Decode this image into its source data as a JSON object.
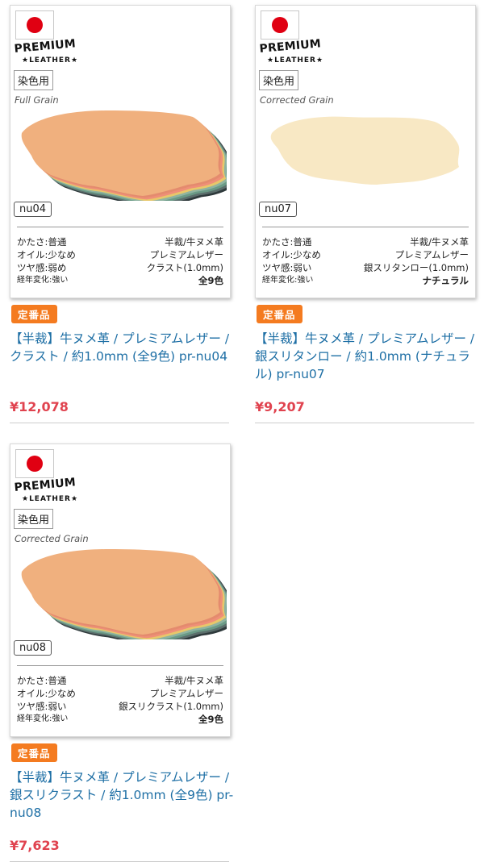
{
  "products": [
    {
      "badge_flag": "Japan flag",
      "logo_top": "PREMIUM",
      "logo_bottom": "★LEATHER★",
      "tag": "染色用",
      "grain": "Full Grain",
      "code": "nu04",
      "specs": [
        {
          "left": "かたさ:普通",
          "right": "半裁/牛ヌメ革"
        },
        {
          "left": "オイル:少なめ",
          "right": "プレミアムレザー"
        },
        {
          "left": "ツヤ感:弱め",
          "right": "クラスト(1.0mm)"
        },
        {
          "left": "経年変化:強い",
          "right": "全9色"
        }
      ],
      "badge": "定番品",
      "title": "【半裁】牛ヌメ革 / プレミアムレザー / クラスト / 約1.0mm (全9色) pr-nu04",
      "price": "¥12,078",
      "hide_layers": [
        "#2f3a3c",
        "#5b6e6c",
        "#6a9a86",
        "#8fb3a0",
        "#e8c76a",
        "#ef8f78",
        "#e48b6e",
        "#f0b07e"
      ]
    },
    {
      "badge_flag": "Japan flag",
      "logo_top": "PREMIUM",
      "logo_bottom": "★LEATHER★",
      "tag": "染色用",
      "grain": "Corrected Grain",
      "code": "nu07",
      "specs": [
        {
          "left": "かたさ:普通",
          "right": "半裁/牛ヌメ革"
        },
        {
          "left": "オイル:少なめ",
          "right": "プレミアムレザー"
        },
        {
          "left": "ツヤ感:弱い",
          "right": "銀スリタンロー(1.0mm)"
        },
        {
          "left": "経年変化:強い",
          "right": "ナチュラル"
        }
      ],
      "badge": "定番品",
      "title": "【半裁】牛ヌメ革 / プレミアムレザー / 銀スリタンロー / 約1.0mm (ナチュラル) pr-nu07",
      "price": "¥9,207",
      "hide_layers": [
        "#f8e8c4"
      ]
    },
    {
      "badge_flag": "Japan flag",
      "logo_top": "PREMIUM",
      "logo_bottom": "★LEATHER★",
      "tag": "染色用",
      "grain": "Corrected Grain",
      "code": "nu08",
      "specs": [
        {
          "left": "かたさ:普通",
          "right": "半裁/牛ヌメ革"
        },
        {
          "left": "オイル:少なめ",
          "right": "プレミアムレザー"
        },
        {
          "left": "ツヤ感:弱い",
          "right": "銀スリクラスト(1.0mm)"
        },
        {
          "left": "経年変化:強い",
          "right": "全9色"
        }
      ],
      "badge": "定番品",
      "title": "【半裁】牛ヌメ革 / プレミアムレザー / 銀スリクラスト / 約1.0mm (全9色) pr-nu08",
      "price": "¥7,623",
      "hide_layers": [
        "#2f3a3c",
        "#5b6e6c",
        "#6a9a86",
        "#8fb3a0",
        "#e8c76a",
        "#ef8f78",
        "#e48b6e",
        "#f0b07e"
      ]
    }
  ]
}
